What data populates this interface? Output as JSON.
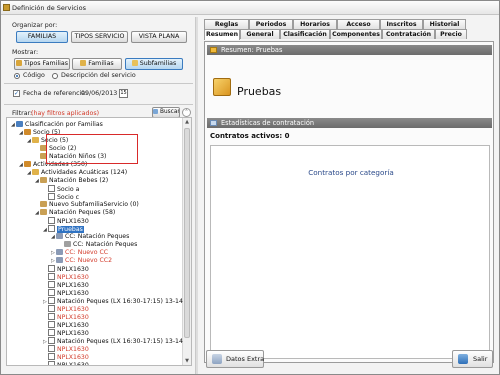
{
  "window": {
    "title": "Definición de Servicios"
  },
  "left": {
    "organize_label": "Organizar por:",
    "organize_buttons": [
      "FAMILIAS",
      "TIPOS SERVICIO",
      "VISTA PLANA"
    ],
    "show_label": "Mostrar:",
    "show_buttons": [
      "Tipos Familias",
      "Familias",
      "Subfamilias"
    ],
    "radio_codigo": "Código",
    "radio_desc": "Descripción del servicio",
    "ref_date_label": "Fecha de referencia:",
    "ref_date_value": "09/06/2013",
    "filter_label": "Filtrar:",
    "filter_note": "(hay filtros aplicados)",
    "search_button": "Buscar",
    "tree": [
      {
        "text": "Clasificación por Familias",
        "level": 0,
        "toggle": "◢",
        "icon": "folder",
        "red": false,
        "cb": false
      },
      {
        "text": "Socio (5)",
        "level": 1,
        "toggle": "◢",
        "icon": "family",
        "red": false,
        "cb": false
      },
      {
        "text": "Socio (5)",
        "level": 2,
        "toggle": "◢",
        "icon": "sub",
        "red": false,
        "cb": false
      },
      {
        "text": "Socio (2)",
        "level": 3,
        "toggle": "",
        "icon": "item",
        "red": false,
        "cb": false
      },
      {
        "text": "Natación Niños (3)",
        "level": 3,
        "toggle": "",
        "icon": "item",
        "red": false,
        "cb": false
      },
      {
        "text": "Actividades (350)",
        "level": 1,
        "toggle": "◢",
        "icon": "family",
        "red": false,
        "cb": false
      },
      {
        "text": "Actividades Acuáticas (124)",
        "level": 2,
        "toggle": "◢",
        "icon": "sub",
        "red": false,
        "cb": false
      },
      {
        "text": "Natación Bebes (2)",
        "level": 3,
        "toggle": "◢",
        "icon": "item",
        "red": false,
        "cb": false
      },
      {
        "text": "Socio a",
        "level": 4,
        "toggle": "",
        "icon": "",
        "red": false,
        "cb": true
      },
      {
        "text": "Socio c",
        "level": 4,
        "toggle": "",
        "icon": "",
        "red": false,
        "cb": true
      },
      {
        "text": "Nuevo SubfamiliaServicio (0)",
        "level": 3,
        "toggle": "",
        "icon": "item",
        "red": false,
        "cb": false
      },
      {
        "text": "Natación Peques (58)",
        "level": 3,
        "toggle": "◢",
        "icon": "item",
        "red": false,
        "cb": false
      },
      {
        "text": "NPLX1630",
        "level": 4,
        "toggle": "",
        "icon": "",
        "red": false,
        "cb": true
      },
      {
        "text": "Pruebas",
        "level": 4,
        "toggle": "◢",
        "icon": "",
        "red": false,
        "cb": true,
        "highlight": true
      },
      {
        "text": "CC: Natación Peques",
        "level": 5,
        "toggle": "◢",
        "icon": "cc",
        "red": false,
        "cb": false
      },
      {
        "text": "CC: Natación Peques",
        "level": 6,
        "toggle": "",
        "icon": "cc2",
        "red": false,
        "cb": false
      },
      {
        "text": "CC: Nuevo CC",
        "level": 5,
        "toggle": "▷",
        "icon": "cc",
        "red": true,
        "cb": false
      },
      {
        "text": "CC: Nuevo CC2",
        "level": 5,
        "toggle": "▷",
        "icon": "cc",
        "red": true,
        "cb": false
      },
      {
        "text": "NPLX1630",
        "level": 4,
        "toggle": "",
        "icon": "",
        "red": false,
        "cb": true
      },
      {
        "text": "NPLX1630",
        "level": 4,
        "toggle": "",
        "icon": "",
        "red": true,
        "cb": true
      },
      {
        "text": "NPLX1630",
        "level": 4,
        "toggle": "",
        "icon": "",
        "red": false,
        "cb": true
      },
      {
        "text": "NPLX1630",
        "level": 4,
        "toggle": "",
        "icon": "",
        "red": false,
        "cb": true
      },
      {
        "text": "Natación Peques (LX 16:30-17:15) 13-14",
        "level": 4,
        "toggle": "▷",
        "icon": "",
        "red": false,
        "cb": true
      },
      {
        "text": "NPLX1630",
        "level": 4,
        "toggle": "",
        "icon": "",
        "red": true,
        "cb": true
      },
      {
        "text": "NPLX1630",
        "level": 4,
        "toggle": "",
        "icon": "",
        "red": true,
        "cb": true
      },
      {
        "text": "NPLX1630",
        "level": 4,
        "toggle": "",
        "icon": "",
        "red": false,
        "cb": true
      },
      {
        "text": "NPLX1630",
        "level": 4,
        "toggle": "",
        "icon": "",
        "red": false,
        "cb": true
      },
      {
        "text": "Natación Peques (LX 16:30-17:15) 13-14",
        "level": 4,
        "toggle": "▷",
        "icon": "",
        "red": false,
        "cb": true
      },
      {
        "text": "NPLX1630",
        "level": 4,
        "toggle": "",
        "icon": "",
        "red": true,
        "cb": true
      },
      {
        "text": "NPLX1630",
        "level": 4,
        "toggle": "",
        "icon": "",
        "red": true,
        "cb": true
      },
      {
        "text": "NPLX1630",
        "level": 4,
        "toggle": "",
        "icon": "",
        "red": false,
        "cb": true
      }
    ]
  },
  "tabs_row1": [
    "Reglas",
    "Periodos",
    "Horarios",
    "Acceso",
    "Inscritos",
    "Historial"
  ],
  "tabs_row2": [
    "Resumen",
    "General",
    "Clasificación",
    "Componentes",
    "Contratación",
    "Precio"
  ],
  "summary": {
    "header": "Resumen: Pruebas",
    "name": "Pruebas",
    "stats_header": "Estadísticas de contratación",
    "active_label": "Contratos activos:",
    "active_value": "0",
    "chart_title": "Contratos por categoría"
  },
  "footer": {
    "extra_button": "Datos Extra",
    "exit_button": "Salir"
  }
}
